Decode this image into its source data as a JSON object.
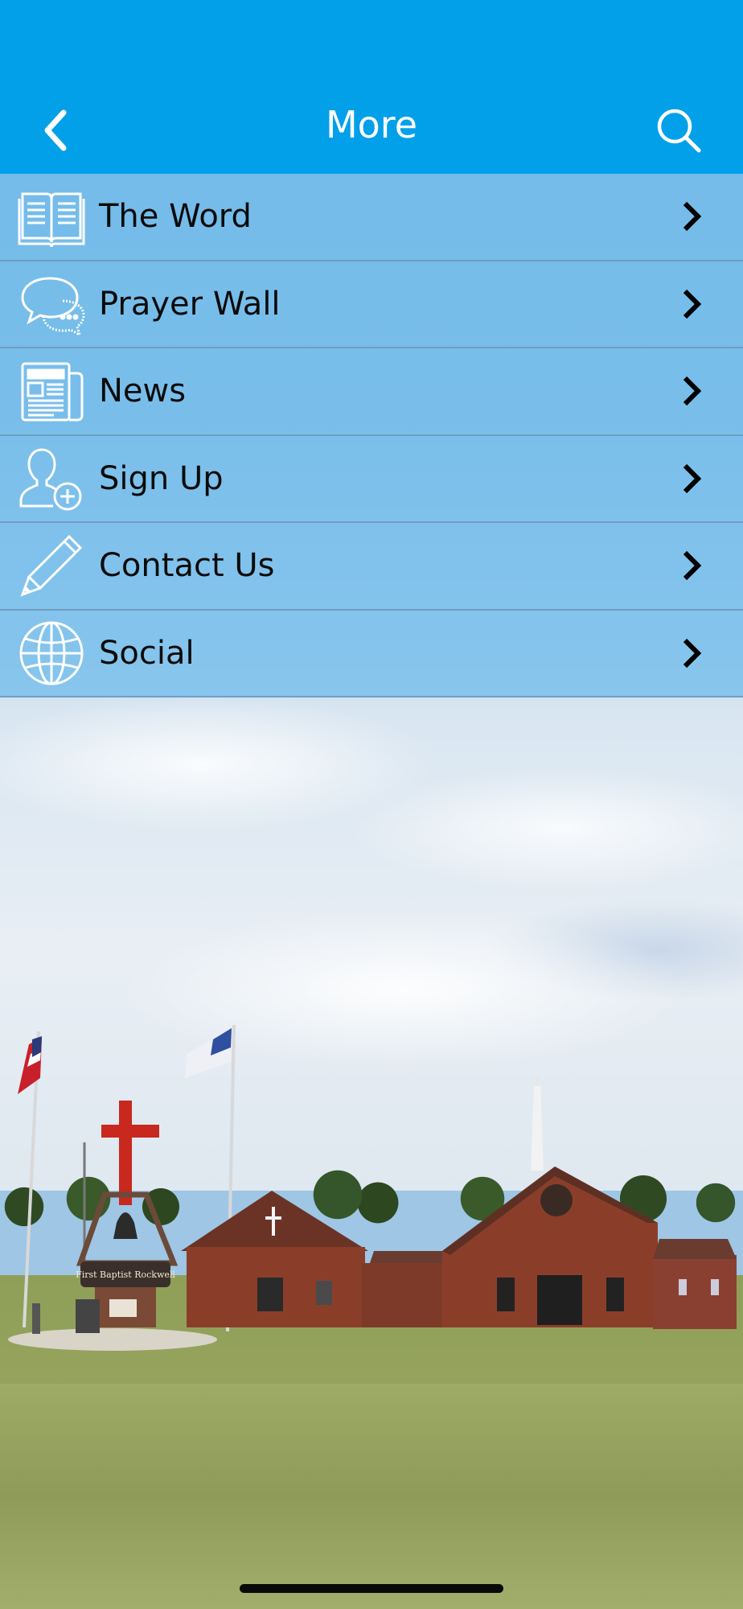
{
  "header": {
    "title": "More",
    "back_icon": "chevron-left-icon",
    "search_icon": "search-icon",
    "background_color": "#03a0ea"
  },
  "menu": {
    "items": [
      {
        "label": "The Word",
        "icon": "open-book-icon"
      },
      {
        "label": "Prayer Wall",
        "icon": "chat-bubbles-icon"
      },
      {
        "label": "News",
        "icon": "newspaper-icon"
      },
      {
        "label": "Sign Up",
        "icon": "add-user-icon"
      },
      {
        "label": "Contact Us",
        "icon": "pencil-icon"
      },
      {
        "label": "Social",
        "icon": "globe-icon"
      }
    ],
    "chevron_icon": "chevron-right-icon",
    "row_color": "#76beec"
  },
  "background": {
    "sign_text": "First Baptist Rockwell"
  }
}
